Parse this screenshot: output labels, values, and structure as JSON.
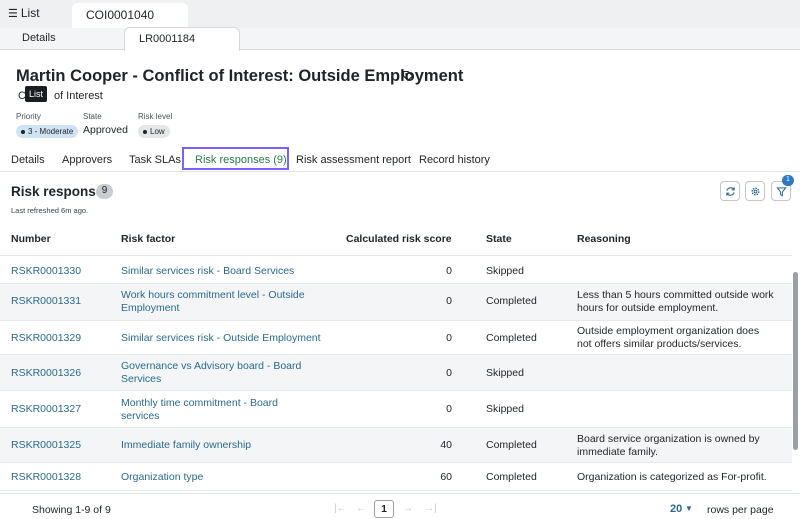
{
  "top_tabs": {
    "list_label": "List",
    "record_tab": "COI0001040"
  },
  "sub_tabs": {
    "details": "Details",
    "active": "LR0001184"
  },
  "header": {
    "title": "Martin Cooper - Conflict of Interest: Outside Employment",
    "subtitle_visible": "C",
    "subtitle_rest": "of Interest",
    "tooltip": "List"
  },
  "meta": {
    "priority_label": "Priority",
    "priority_value": "3 - Moderate",
    "state_label": "State",
    "state_value": "Approved",
    "risk_label": "Risk level",
    "risk_value": "Low"
  },
  "record_tabs": [
    "Details",
    "Approvers",
    "Task SLAs",
    "Risk responses (9)",
    "Risk assessment report",
    "Record history"
  ],
  "section": {
    "title": "Risk responses",
    "count": "9",
    "refreshed": "Last refreshed 6m ago.",
    "filter_count": "1"
  },
  "table": {
    "columns": [
      "Number",
      "Risk factor",
      "Calculated risk score",
      "State",
      "Reasoning"
    ],
    "rows": [
      {
        "number": "RSKR0001330",
        "risk_factor": [
          "Similar services risk - Board Services"
        ],
        "score": "0",
        "state": "Skipped",
        "reasoning": []
      },
      {
        "number": "RSKR0001331",
        "risk_factor": [
          "Work hours commitment level - Outside",
          "Employment"
        ],
        "score": "0",
        "state": "Completed",
        "reasoning": [
          "Less than 5 hours committed outside work",
          "hours for outside employment."
        ]
      },
      {
        "number": "RSKR0001329",
        "risk_factor": [
          "Similar services risk - Outside Employment"
        ],
        "score": "0",
        "state": "Completed",
        "reasoning": [
          "Outside employment organization does",
          "not offers similar products/services."
        ]
      },
      {
        "number": "RSKR0001326",
        "risk_factor": [
          "Governance vs Advisory board - Board",
          "Services"
        ],
        "score": "0",
        "state": "Skipped",
        "reasoning": []
      },
      {
        "number": "RSKR0001327",
        "risk_factor": [
          "Monthly time commitment - Board",
          "services"
        ],
        "score": "0",
        "state": "Skipped",
        "reasoning": []
      },
      {
        "number": "RSKR0001325",
        "risk_factor": [
          "Immediate family ownership"
        ],
        "score": "40",
        "state": "Completed",
        "reasoning": [
          "Board service organization is owned by",
          "immediate family."
        ]
      },
      {
        "number": "RSKR0001328",
        "risk_factor": [
          "Organization type"
        ],
        "score": "60",
        "state": "Completed",
        "reasoning": [
          "Organization is categorized as For-profit."
        ]
      }
    ]
  },
  "footer": {
    "showing": "Showing 1-9 of 9",
    "current_page": "1",
    "rows_per_page_value": "20",
    "rows_per_page_label": "rows per page"
  },
  "colors": {
    "accent_purple": "#7b61ff",
    "link": "#2a6a8a",
    "active_tab_text": "#2b7a48",
    "priority_pill": "#cfe3f5",
    "low_pill": "#e4e6e8"
  }
}
